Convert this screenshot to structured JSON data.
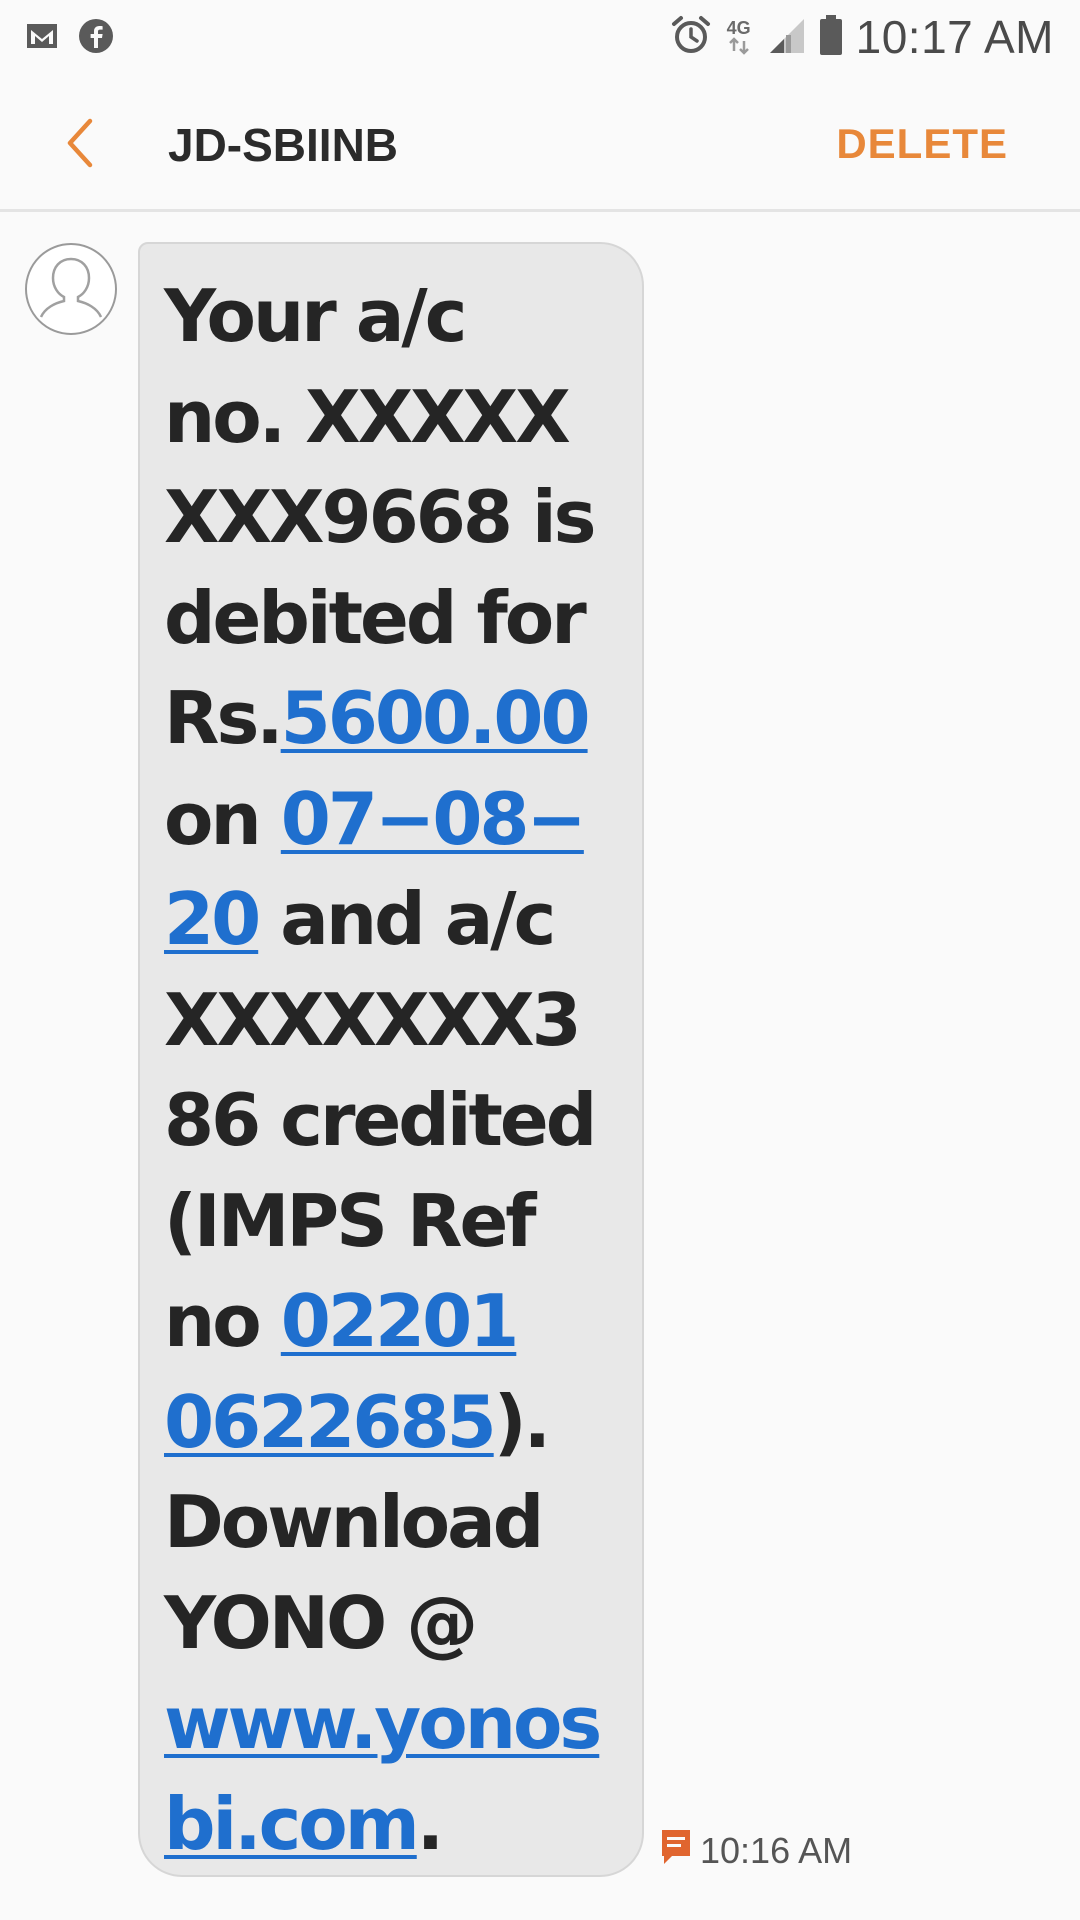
{
  "status_bar": {
    "time": "10:17 AM",
    "network_type": "4G",
    "notification_icons": [
      "gmail-icon",
      "facebook-icon"
    ],
    "system_icons": [
      "alarm-icon",
      "network-arrows-icon",
      "signal-icon",
      "battery-icon"
    ]
  },
  "header": {
    "contact_name": "JD-SBIINB",
    "delete_label": "DELETE",
    "accent_color": "#e8883a"
  },
  "message": {
    "lines": [
      {
        "text": "Your a/c"
      },
      {
        "text": "no. XXXXX"
      },
      {
        "text": "XXX9668 is"
      },
      {
        "text": "debited for"
      },
      {
        "pre": "Rs.",
        "link": "5600.00"
      },
      {
        "pre": "on ",
        "link": "07−08−"
      },
      {
        "link": "20",
        "post": " and a/c"
      },
      {
        "text": "XXXXXXX3"
      },
      {
        "text": "86 credited"
      },
      {
        "text": "(IMPS Ref"
      },
      {
        "pre": "no ",
        "link": "02201"
      },
      {
        "link": "0622685",
        "post": ")."
      },
      {
        "text": "Download"
      },
      {
        "text": "YONO @"
      },
      {
        "link": "www.yonos"
      },
      {
        "link": "bi.com",
        "post": "."
      }
    ],
    "time": "10:16 AM",
    "link_color": "#1f6fce",
    "bubble_color": "#e8e8e8"
  }
}
